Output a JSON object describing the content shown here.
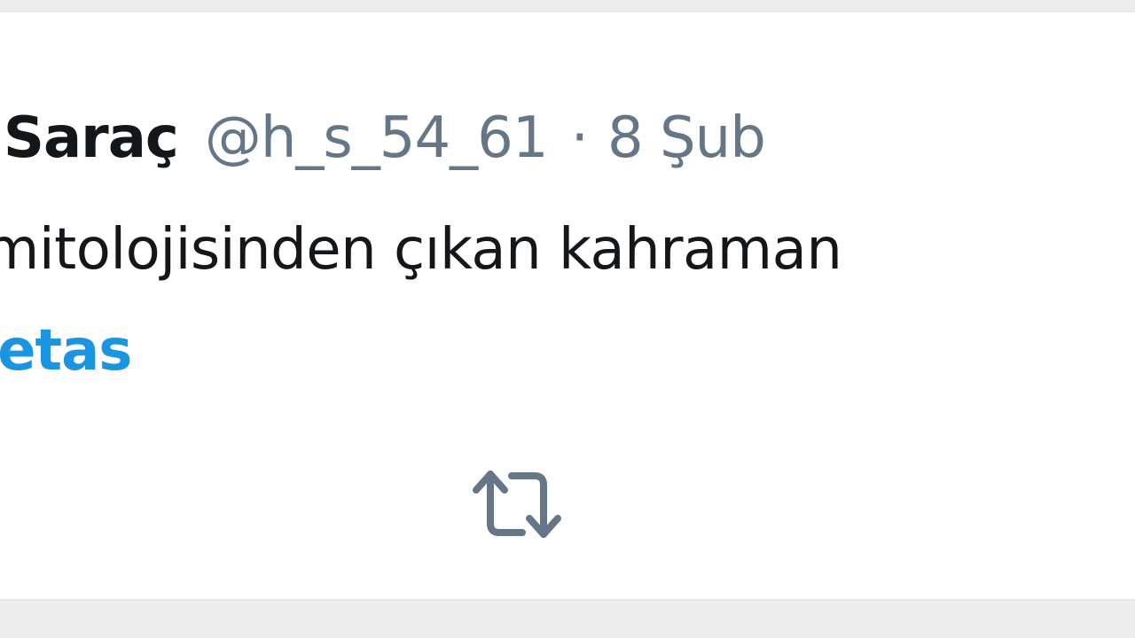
{
  "tweet": {
    "display_name": "n Saraç",
    "handle": "@h_s_54_61",
    "separator": "·",
    "date": "8 Şub",
    "text_fragment": "mitolojisinden çıkan kahraman",
    "hashtag_fragment": "setas"
  },
  "actions": {
    "retweet_icon": "retweet-icon"
  },
  "colors": {
    "name": "#14171a",
    "meta": "#657786",
    "hashtag": "#1b95e0",
    "icon": "#657786",
    "background": "#ffffff"
  }
}
